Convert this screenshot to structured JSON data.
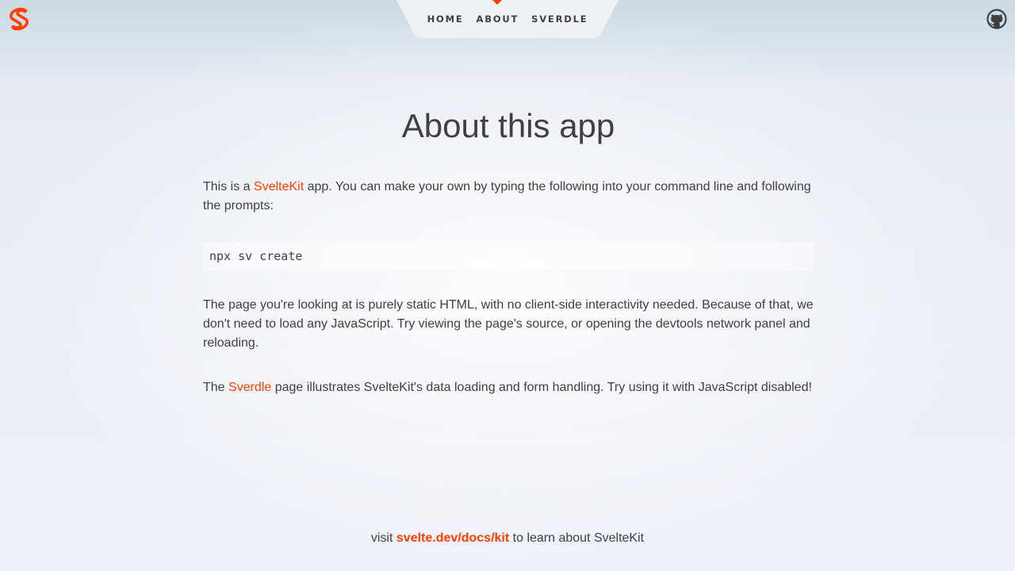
{
  "header": {
    "logo_icon": "svelte-logo-icon",
    "github_icon": "github-icon",
    "nav": [
      {
        "label": "Home",
        "active": false
      },
      {
        "label": "About",
        "active": true
      },
      {
        "label": "Sverdle",
        "active": false
      }
    ]
  },
  "main": {
    "title": "About this app",
    "p1": {
      "before": "This is a ",
      "link": "SvelteKit",
      "after": " app. You can make your own by typing the following into your command line and following the prompts:"
    },
    "code": "npx sv create",
    "p2": "The page you're looking at is purely static HTML, with no client-side interactivity needed. Because of that, we don't need to load any JavaScript. Try viewing the page's source, or opening the devtools network panel and reloading.",
    "p3": {
      "before": "The ",
      "link": "Sverdle",
      "after": " page illustrates SvelteKit's data loading and form handling. Try using it with JavaScript disabled!"
    }
  },
  "footer": {
    "before": "visit ",
    "link": "svelte.dev/docs/kit",
    "after": " to learn about SvelteKit"
  },
  "colors": {
    "accent": "#ff3e00",
    "text": "#404040",
    "nav_bg": "#eef1f5"
  }
}
